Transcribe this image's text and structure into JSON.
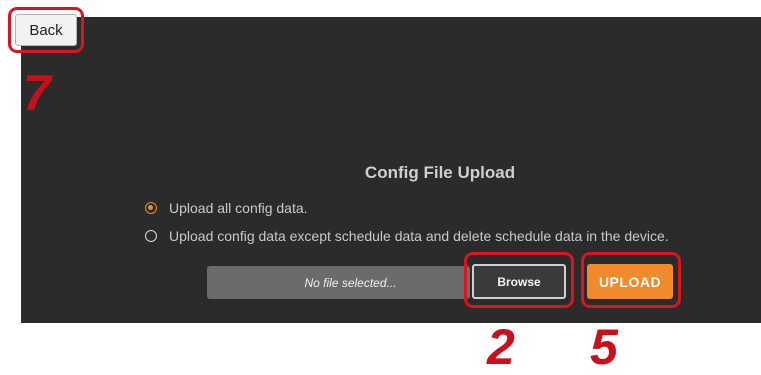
{
  "header": {
    "back_label": "Back"
  },
  "page": {
    "title": "Config File Upload"
  },
  "options": [
    {
      "label": "Upload all config data.",
      "selected": true
    },
    {
      "label": "Upload config data except schedule data and delete schedule data in the device.",
      "selected": false
    }
  ],
  "file": {
    "placeholder": "No file selected..."
  },
  "buttons": {
    "browse_label": "Browse",
    "upload_label": "UPLOAD"
  },
  "callouts": {
    "back_step": "7",
    "browse_step": "2",
    "upload_step": "5"
  },
  "colors": {
    "panel_bg": "#2b2b2b",
    "accent": "#f08a2a",
    "callout": "#d8161f"
  }
}
